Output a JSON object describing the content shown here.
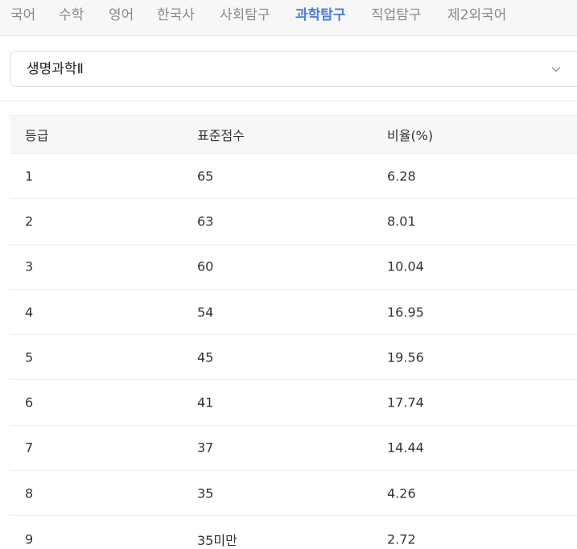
{
  "tabs": [
    {
      "label": "국어",
      "active": false
    },
    {
      "label": "수학",
      "active": false
    },
    {
      "label": "영어",
      "active": false
    },
    {
      "label": "한국사",
      "active": false
    },
    {
      "label": "사회탐구",
      "active": false
    },
    {
      "label": "과학탐구",
      "active": true
    },
    {
      "label": "직업탐구",
      "active": false
    },
    {
      "label": "제2외국어",
      "active": false
    }
  ],
  "subject_select": {
    "value": "생명과학Ⅱ",
    "icon": "chevron-down-icon"
  },
  "table": {
    "headers": [
      "등급",
      "표준점수",
      "비율(%)"
    ],
    "rows": [
      [
        "1",
        "65",
        "6.28"
      ],
      [
        "2",
        "63",
        "8.01"
      ],
      [
        "3",
        "60",
        "10.04"
      ],
      [
        "4",
        "54",
        "16.95"
      ],
      [
        "5",
        "45",
        "19.56"
      ],
      [
        "6",
        "41",
        "17.74"
      ],
      [
        "7",
        "37",
        "14.44"
      ],
      [
        "8",
        "35",
        "4.26"
      ],
      [
        "9",
        "35미만",
        "2.72"
      ]
    ]
  },
  "colors": {
    "active_tab": "#4a7ee0",
    "inactive_tab": "#8a8a8a",
    "header_bg": "#f7f7f7",
    "border": "#ececec"
  }
}
